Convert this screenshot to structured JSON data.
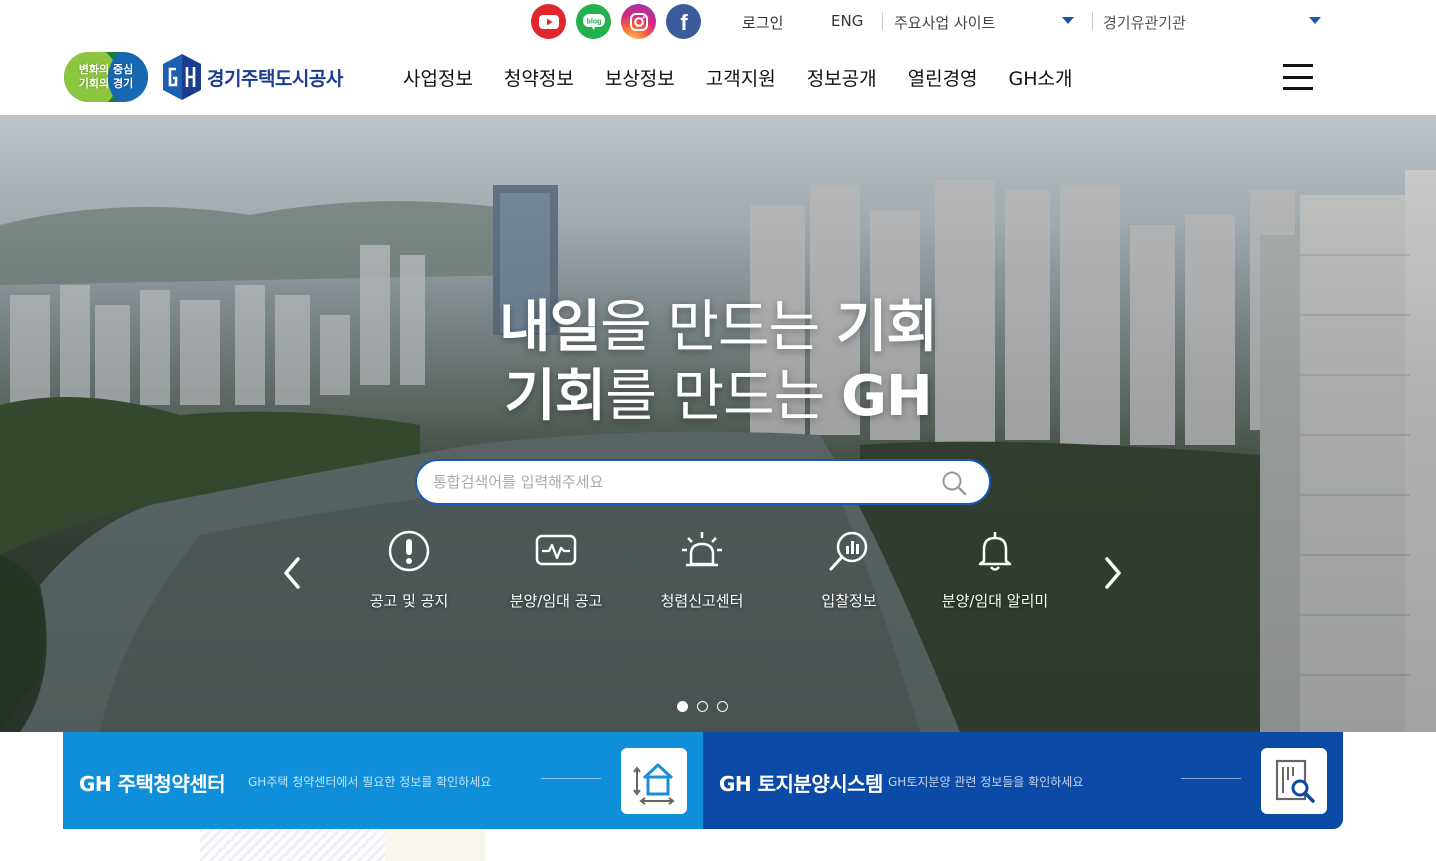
{
  "sns": {
    "youtube": "youtube-icon",
    "blog": "blog",
    "instagram": "instagram-icon",
    "facebook": "f"
  },
  "utility": {
    "login": "로그인",
    "eng": "ENG",
    "main_sites": "주요사업 사이트",
    "institutions": "경기유관기관"
  },
  "brand": {
    "slogan_line1": "변화의 중심",
    "slogan_line2": "기회의 경기",
    "logo_text": "경기주택도시공사"
  },
  "nav": [
    "사업정보",
    "청약정보",
    "보상정보",
    "고객지원",
    "정보공개",
    "열린경영",
    "GH소개"
  ],
  "hero": {
    "line1_bold_a": "내일",
    "line1_thin": "을 만드는 ",
    "line1_bold_b": "기회",
    "line2_bold_a": "기회",
    "line2_thin": "를 만드는 ",
    "line2_bold_b": "GH",
    "search_placeholder": "통합검색어를 입력해주세요"
  },
  "quick_links": [
    {
      "label": "공고 및 공지",
      "icon": "notice-alert-icon"
    },
    {
      "label": "분양/임대 공고",
      "icon": "pulse-monitor-icon"
    },
    {
      "label": "청렴신고센터",
      "icon": "siren-icon"
    },
    {
      "label": "입찰정보",
      "icon": "magnifier-chart-icon"
    },
    {
      "label": "분양/임대 알리미",
      "icon": "bell-icon"
    }
  ],
  "slider": {
    "total": 3,
    "active": 1
  },
  "banners": [
    {
      "title": "GH 주택청약센터",
      "desc": "GH주택 청약센터에서 필요한 정보를 확인하세요",
      "icon": "house-icon",
      "color": "#0f8fd9"
    },
    {
      "title": "GH 토지분양시스템",
      "desc": "GH토지분양 관련 정보들을 확인하세요",
      "icon": "document-search-icon",
      "color": "#0b4aa6"
    }
  ],
  "colors": {
    "accent": "#1a58b6",
    "brand_navy": "#1b3d8f"
  }
}
